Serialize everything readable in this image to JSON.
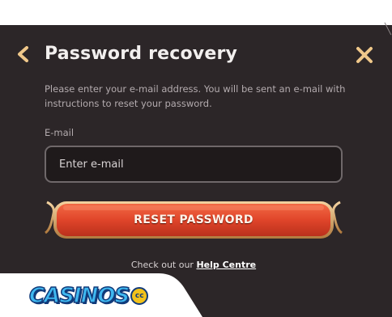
{
  "dialog": {
    "title": "Password recovery",
    "description": "Please enter your e-mail address. You will be sent an e-mail with instructions to reset your password.",
    "email_label": "E-mail",
    "email_placeholder": "Enter e-mail",
    "email_value": "",
    "reset_button_label": "RESET PASSWORD",
    "help_prefix": "Check out our",
    "help_link_label": "Help Centre"
  },
  "watermark": {
    "brand_text": "CASINOS",
    "brand_suffix": "cc"
  },
  "icons": {
    "back": "chevron-left-icon",
    "close": "close-icon"
  },
  "colors": {
    "panel_bg": "#2c2628",
    "accent_gold": "#f0c88a",
    "button_red": "#e0452a",
    "button_frame": "#d4a062",
    "brand_blue": "#3fb8f0"
  }
}
